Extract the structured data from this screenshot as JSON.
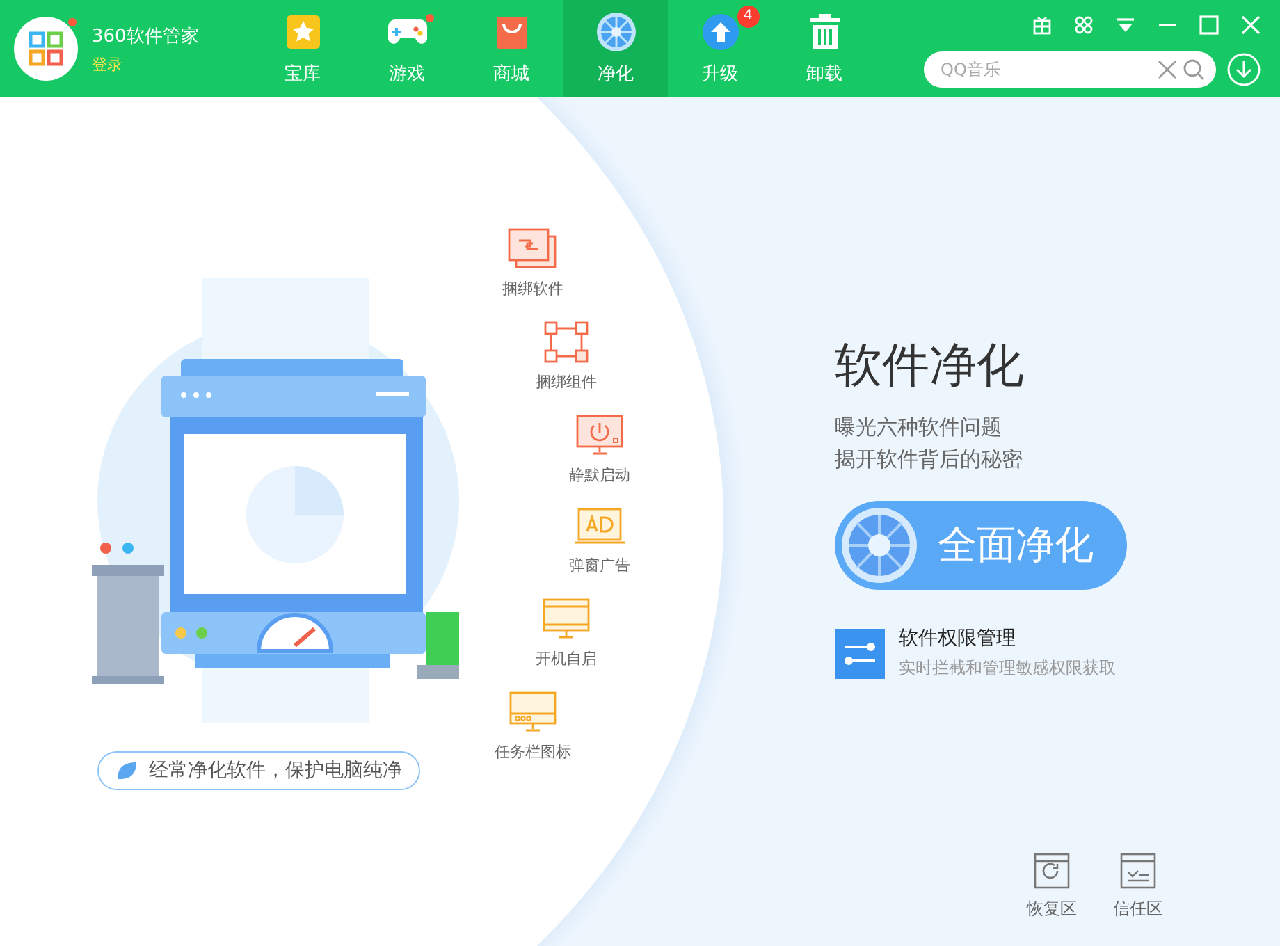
{
  "app": {
    "name": "360软件管家",
    "login": "登录",
    "notice": true
  },
  "tabs": [
    {
      "label": "宝库",
      "kind": "star",
      "selected": false,
      "notice": false
    },
    {
      "label": "游戏",
      "kind": "gamepad",
      "selected": false,
      "notice": true
    },
    {
      "label": "商城",
      "kind": "bag",
      "selected": false,
      "notice": false
    },
    {
      "label": "净化",
      "kind": "fan",
      "selected": true,
      "notice": false
    },
    {
      "label": "升级",
      "kind": "upgrade",
      "selected": false,
      "notice": false,
      "badge": "4"
    },
    {
      "label": "卸载",
      "kind": "trash",
      "selected": false,
      "notice": false
    }
  ],
  "search": {
    "placeholder": "QQ音乐"
  },
  "features": [
    {
      "label": "捆绑软件",
      "kind": "bundle"
    },
    {
      "label": "捆绑组件",
      "kind": "nodes"
    },
    {
      "label": "静默启动",
      "kind": "power"
    },
    {
      "label": "弹窗广告",
      "kind": "ad"
    },
    {
      "label": "开机自启",
      "kind": "monitor"
    },
    {
      "label": "任务栏图标",
      "kind": "taskbar"
    }
  ],
  "tagline": "经常净化软件，保护电脑纯净",
  "panel": {
    "title": "软件净化",
    "lines": [
      "曝光六种软件问题",
      "揭开软件背后的秘密"
    ],
    "button": "全面净化",
    "permission": {
      "title": "软件权限管理",
      "subtitle": "实时拦截和管理敏感权限获取"
    }
  },
  "zones": [
    {
      "label": "恢复区",
      "kind": "restore"
    },
    {
      "label": "信任区",
      "kind": "trust"
    }
  ]
}
